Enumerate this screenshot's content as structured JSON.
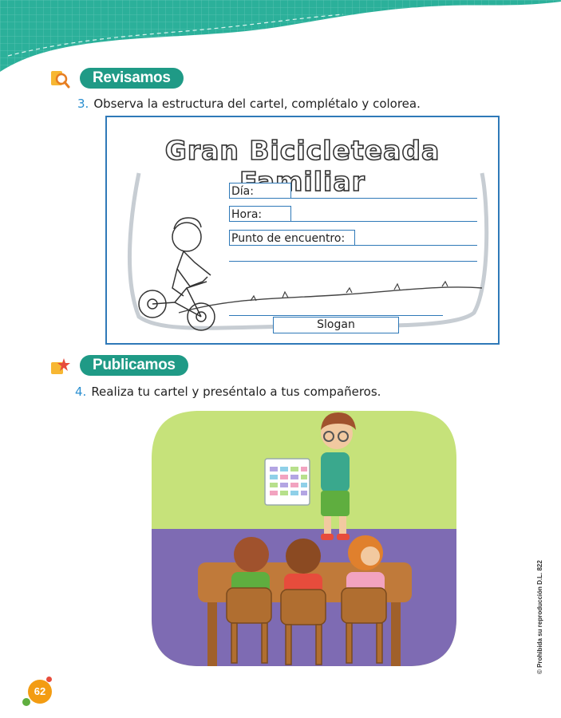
{
  "colors": {
    "band": "#2bb09a",
    "accent": "#1f9a86",
    "blue": "#2f79b8",
    "number": "#2a8fd0",
    "page_badge": "#f39c12"
  },
  "sections": {
    "review": {
      "label": "Revisamos",
      "icon": "magnifier-icon"
    },
    "publish": {
      "label": "Publicamos",
      "icon": "star-note-icon"
    }
  },
  "activities": {
    "three": {
      "number": "3.",
      "text": "Observa la estructura del cartel, complétalo y colorea."
    },
    "four": {
      "number": "4.",
      "text": "Realiza tu cartel y preséntalo a tus compañeros."
    }
  },
  "poster": {
    "title": "Gran Bicicleteada Familiar",
    "fields": {
      "day": "Día:",
      "time": "Hora:",
      "meeting": "Punto de encuentro:"
    },
    "slogan": "Slogan"
  },
  "side_note": "© Prohibida su reproducción D.L. 822",
  "page_number": "62"
}
